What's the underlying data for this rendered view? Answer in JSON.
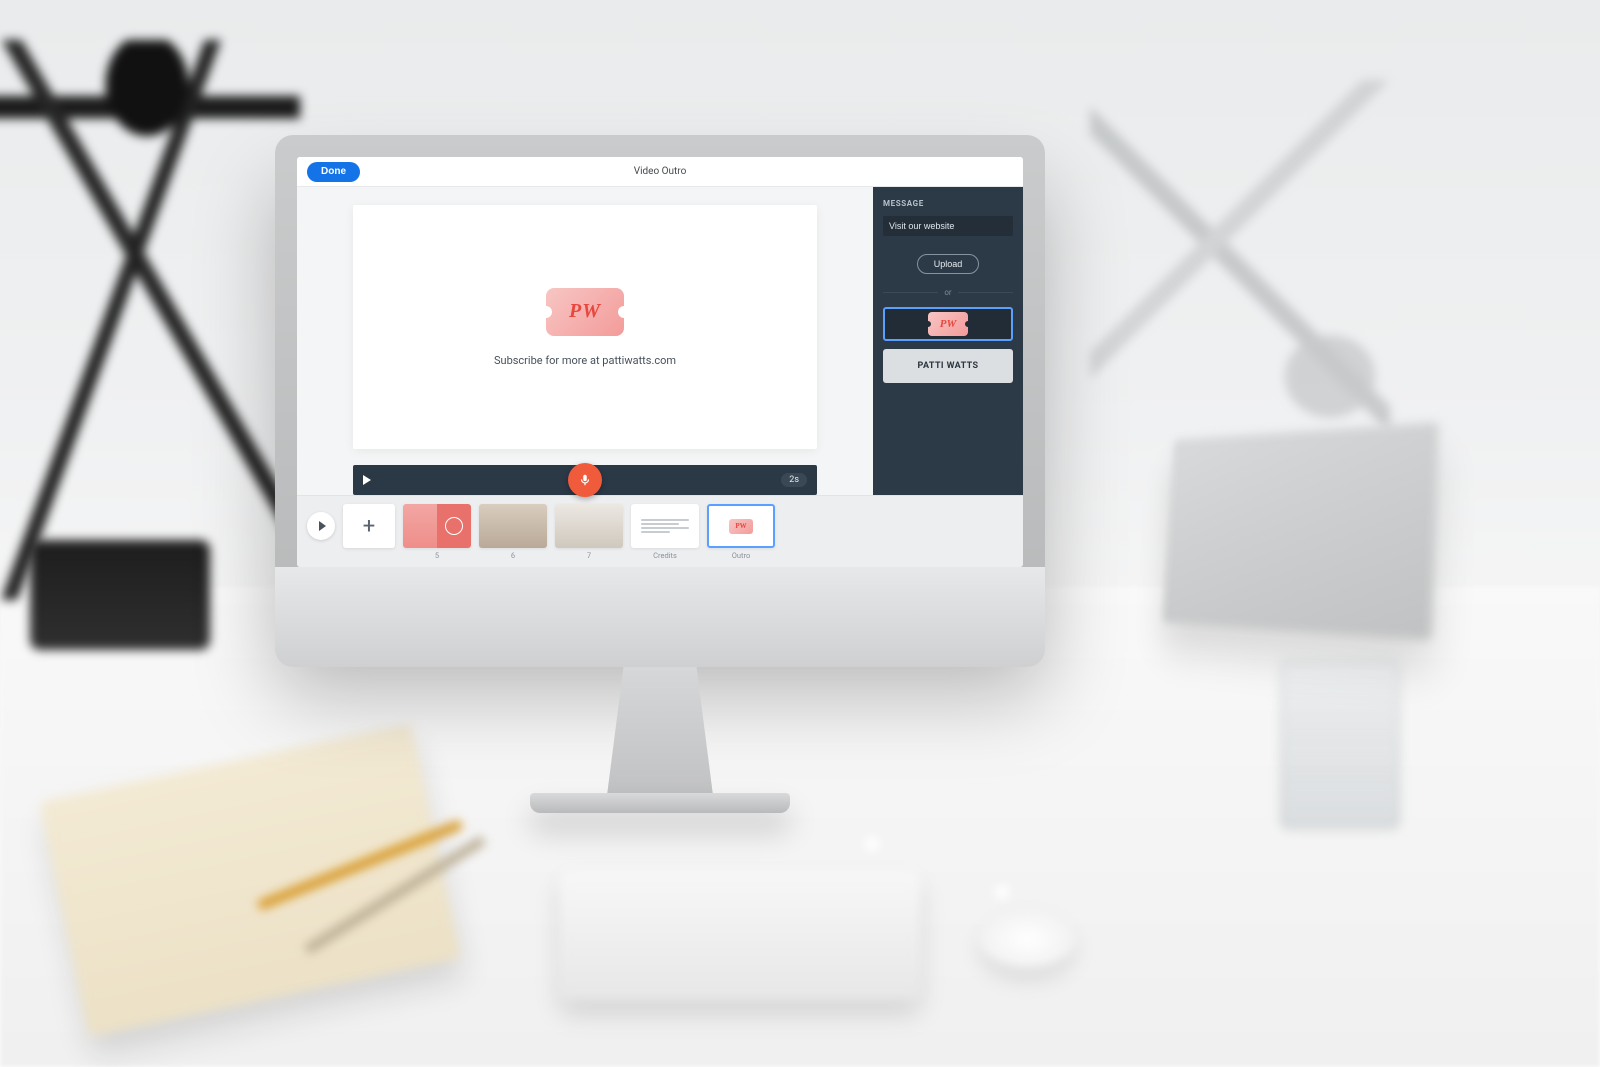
{
  "topbar": {
    "done_label": "Done",
    "title": "Video Outro"
  },
  "slide": {
    "logo_text": "PW",
    "caption": "Subscribe for more at pattiwatts.com"
  },
  "player": {
    "duration": "2s"
  },
  "sidepanel": {
    "message_label": "MESSAGE",
    "message_value": "Visit our website",
    "upload_label": "Upload",
    "or_label": "or",
    "asset_logo_text": "PW",
    "asset_text_label": "PATTI WATTS"
  },
  "storyboard": {
    "add_label": "+",
    "items": [
      {
        "label": "5"
      },
      {
        "label": "6"
      },
      {
        "label": "7"
      },
      {
        "label": "Credits"
      },
      {
        "label": "Outro"
      }
    ],
    "outro_badge": "PW"
  }
}
